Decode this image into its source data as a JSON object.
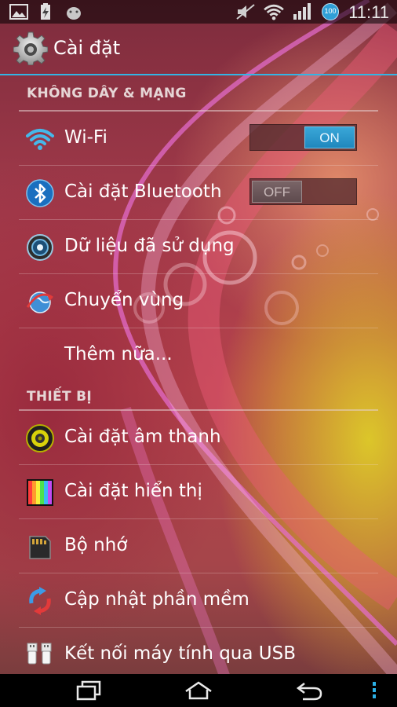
{
  "status_bar": {
    "time": "11:11",
    "battery_level": "100",
    "icons": [
      "gallery-icon",
      "battery-charging-icon",
      "android-debug-icon",
      "mute-icon",
      "wifi-signal-icon",
      "cell-signal-icon",
      "battery-badge-icon"
    ]
  },
  "action_bar": {
    "title": "Cài đặt",
    "icon": "settings-gear-icon"
  },
  "sections": {
    "wireless": {
      "header": "KHÔNG DÂY & MẠNG",
      "items": [
        {
          "label": "Wi-Fi",
          "icon": "wifi-icon",
          "toggle": "ON",
          "toggle_state": "on"
        },
        {
          "label": "Cài đặt Bluetooth",
          "icon": "bluetooth-icon",
          "toggle": "OFF",
          "toggle_state": "off"
        },
        {
          "label": "Dữ liệu đã sử dụng",
          "icon": "data-usage-icon"
        },
        {
          "label": "Chuyển vùng",
          "icon": "roaming-icon"
        },
        {
          "label": "Thêm nữa..."
        }
      ]
    },
    "device": {
      "header": "THIẾT BỊ",
      "items": [
        {
          "label": "Cài đặt âm thanh",
          "icon": "speaker-icon"
        },
        {
          "label": "Cài đặt hiển thị",
          "icon": "display-icon"
        },
        {
          "label": "Bộ nhớ",
          "icon": "sd-card-icon"
        },
        {
          "label": "Cập nhật phần mềm",
          "icon": "software-update-icon"
        },
        {
          "label": "Kết nối máy tính qua USB",
          "icon": "usb-icon"
        }
      ]
    }
  },
  "nav_bar": {
    "buttons": [
      "recent-apps-icon",
      "home-icon",
      "back-icon",
      "menu-icon"
    ]
  },
  "colors": {
    "accent": "#33b5e5",
    "toggle_on": "#2a98cb"
  }
}
